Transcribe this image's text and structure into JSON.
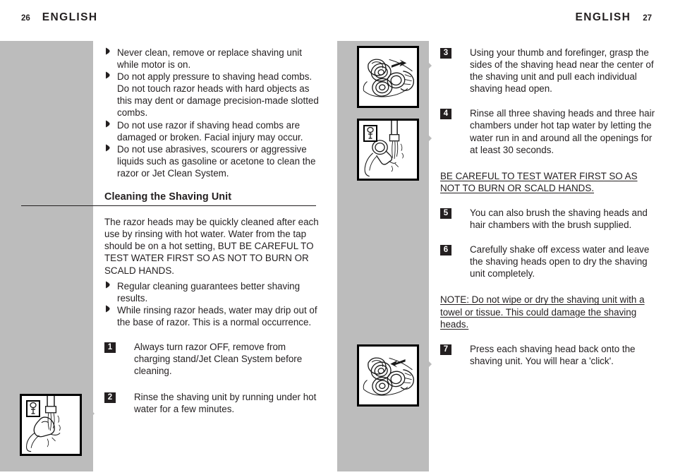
{
  "page": {
    "left_header": {
      "folio": "26",
      "title": "ENGLISH"
    },
    "right_header": {
      "folio": "27",
      "title": "ENGLISH"
    }
  },
  "left_column": {
    "warnings": [
      "Never clean, remove or replace shaving unit while motor is on.",
      "Do not apply pressure to shaving head combs. Do not touch razor heads with hard objects as this may dent or damage precision-made slotted combs.",
      "Do not use razor if shaving head combs are damaged or broken. Facial injury may occur.",
      "Do not use abrasives, scourers or aggressive liquids such as gasoline or acetone to clean the razor or Jet Clean System."
    ],
    "section_heading": "Cleaning the Shaving Unit",
    "intro_paragraph": "The razor heads may be quickly cleaned after each use by rinsing with hot water. Water from the tap should be on a hot setting, BUT BE CAREFUL TO TEST WATER FIRST SO AS NOT TO BURN OR SCALD HANDS.",
    "tips": [
      "Regular cleaning guarantees better shaving results.",
      "While rinsing razor heads, water may drip out of the base of razor. This is a normal occurrence."
    ],
    "steps": [
      {
        "number": "1",
        "text": "Always turn razor OFF, remove from charging stand/Jet Clean System before cleaning."
      },
      {
        "number": "2",
        "text": "Rinse the shaving unit by running under hot water for a few minutes."
      }
    ]
  },
  "right_column": {
    "steps_a": [
      {
        "number": "3",
        "text": "Using your thumb and forefinger, grasp the sides of the shaving head near the center of the shaving unit and pull each individual shaving head open."
      },
      {
        "number": "4",
        "text": "Rinse all three shaving heads and three hair chambers under hot tap water by letting the water run in and around all the openings for at least 30 seconds."
      }
    ],
    "caution": "BE CAREFUL TO TEST WATER FIRST SO AS NOT TO BURN OR SCALD HANDS.",
    "steps_b": [
      {
        "number": "5",
        "text": "You can also brush the shaving heads and hair chambers with the brush supplied."
      },
      {
        "number": "6",
        "text": "Carefully shake off excess water and leave the shaving heads open to dry the shaving unit completely."
      }
    ],
    "note": "NOTE: Do not wipe or dry the shaving unit with a towel or tissue. This could damage the shaving heads.",
    "steps_c": [
      {
        "number": "7",
        "text": "Press each shaving head back onto the shaving unit. You will hear a 'click'."
      }
    ]
  },
  "figures": [
    {
      "id": "figure-shaving-unit-open",
      "caption_ref": "3"
    },
    {
      "id": "figure-rinse-under-tap-right",
      "caption_ref": "4"
    },
    {
      "id": "figure-press-head-back",
      "caption_ref": "7"
    },
    {
      "id": "figure-rinse-under-tap-left",
      "caption_ref": "2"
    }
  ],
  "colors": {
    "band_gray": "#bcbcbc",
    "ink": "#231f20",
    "paper": "#ffffff"
  }
}
